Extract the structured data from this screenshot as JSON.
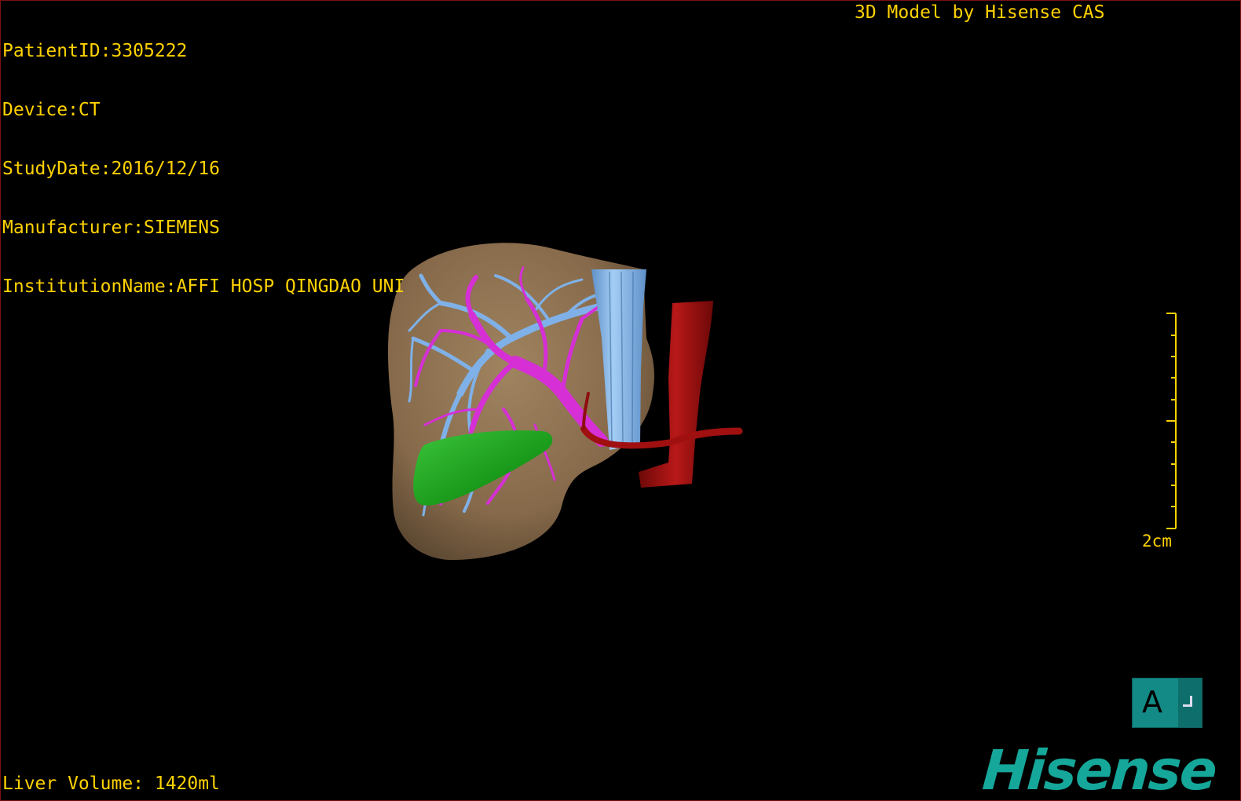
{
  "dicom": {
    "patient_id": "PatientID:3305222",
    "device": "Device:CT",
    "study_date": "StudyDate:2016/12/16",
    "manufacturer": "Manufacturer:SIEMENS",
    "institution": "InstitutionName:AFFI HOSP QINGDAO UNI"
  },
  "brand_caption": "3D Model by Hisense CAS",
  "liver_volume": "Liver Volume: 1420ml",
  "scale_bar": {
    "label": "2cm"
  },
  "orientation": {
    "label": "A"
  },
  "logo_text": "Hisense",
  "colors": {
    "overlay_text": "#ffd200",
    "liver": "#8b6e4b",
    "portal_vein": "#d52fd5",
    "hepatic_vein": "#7fb1e8",
    "ivc": "#8fc1f0",
    "aorta": "#a01010",
    "gallbladder": "#1e9d1e",
    "orientation_cube": "#138a86",
    "logo": "#15a79a"
  }
}
